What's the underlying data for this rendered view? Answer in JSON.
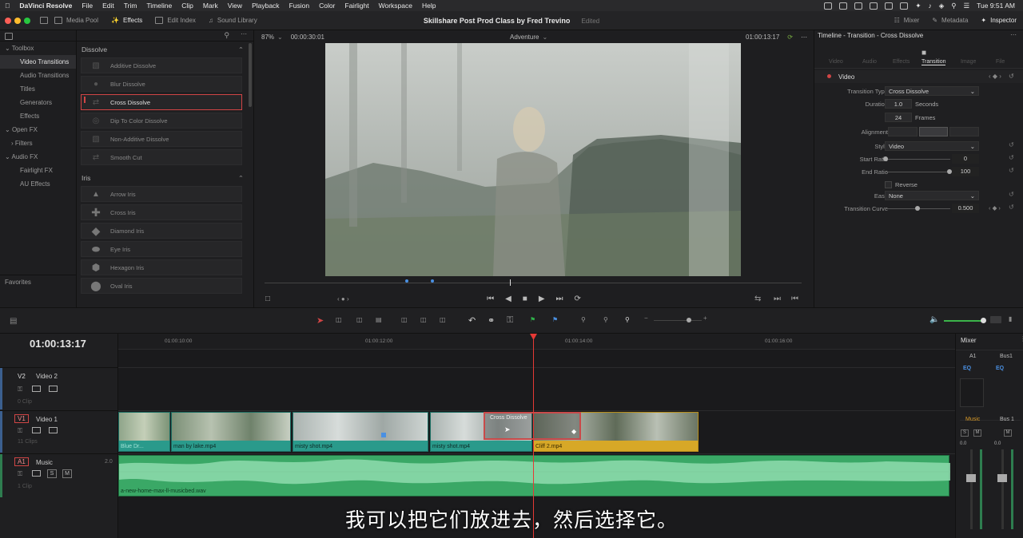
{
  "menubar": {
    "app": "DaVinci Resolve",
    "items": [
      "File",
      "Edit",
      "Trim",
      "Timeline",
      "Clip",
      "Mark",
      "View",
      "Playback",
      "Fusion",
      "Color",
      "Fairlight",
      "Workspace",
      "Help"
    ],
    "clock": "Tue 9:51 AM"
  },
  "toolbar": {
    "media_pool": "Media Pool",
    "effects": "Effects",
    "edit_index": "Edit Index",
    "sound_library": "Sound Library",
    "project_title": "Skillshare Post Prod Class by Fred Trevino",
    "edited": "Edited",
    "mixer": "Mixer",
    "metadata": "Metadata",
    "inspector": "Inspector"
  },
  "left_panel": {
    "toolbox": "Toolbox",
    "items": [
      "Video Transitions",
      "Audio Transitions",
      "Titles",
      "Generators",
      "Effects"
    ],
    "open_fx": "Open FX",
    "filters": "Filters",
    "audio_fx": "Audio FX",
    "audio_items": [
      "Fairlight FX",
      "AU Effects"
    ],
    "favorites": "Favorites"
  },
  "effects": {
    "dissolve_header": "Dissolve",
    "dissolve": [
      "Additive Dissolve",
      "Blur Dissolve",
      "Cross Dissolve",
      "Dip To Color Dissolve",
      "Non-Additive Dissolve",
      "Smooth Cut"
    ],
    "iris_header": "Iris",
    "iris": [
      "Arrow Iris",
      "Cross Iris",
      "Diamond Iris",
      "Eye Iris",
      "Hexagon Iris",
      "Oval Iris"
    ]
  },
  "viewer": {
    "zoom": "87%",
    "duration": "00:00:30:01",
    "timeline_name": "Adventure",
    "timecode": "01:00:13:17"
  },
  "inspector": {
    "title": "Timeline - Transition - Cross Dissolve",
    "tabs": [
      "Video",
      "Audio",
      "Effects",
      "Transition",
      "Image",
      "File"
    ],
    "section": "Video",
    "transition_type_label": "Transition Type",
    "transition_type": "Cross Dissolve",
    "duration_label": "Duration",
    "duration_seconds": "1.0",
    "seconds": "Seconds",
    "duration_frames": "24",
    "frames": "Frames",
    "alignment_label": "Alignment",
    "style_label": "Style",
    "style": "Video",
    "start_ratio_label": "Start Ratio",
    "start_ratio": "0",
    "end_ratio_label": "End Ratio",
    "end_ratio": "100",
    "reverse": "Reverse",
    "ease_label": "Ease",
    "ease": "None",
    "curve_label": "Transition Curve",
    "curve": "0.500"
  },
  "timeline": {
    "timecode": "01:00:13:17",
    "ruler": [
      "01:00:10:00",
      "01:00:12:00",
      "01:00:14:00",
      "01:00:16:00"
    ],
    "tracks": {
      "v2": "V2",
      "v2_name": "Video 2",
      "v2_clips": "0 Clip",
      "v1": "V1",
      "v1_name": "Video 1",
      "v1_clips": "11 Clips",
      "a1": "A1",
      "a1_name": "Music",
      "a1_level": "2.0",
      "a1_clips": "1 Clip",
      "solo": "S",
      "mute": "M"
    },
    "clips": [
      "Blue Dr...",
      "man by lake.mp4",
      "misty shot.mp4",
      "misty shot.mp4",
      "Cliff 2.mp4"
    ],
    "transition": "Cross Dissolve",
    "audio_clip": "a-new-home-max-ll-musicbed.wav"
  },
  "mixer": {
    "title": "Mixer",
    "a1": "A1",
    "bus1": "Bus1",
    "eq": "EQ",
    "music": "Music",
    "bus1b": "Bus 1",
    "s": "S",
    "m": "M",
    "lv1": "0.0",
    "lv2": "0.0"
  },
  "subtitle": "我可以把它们放进去，然后选择它。"
}
